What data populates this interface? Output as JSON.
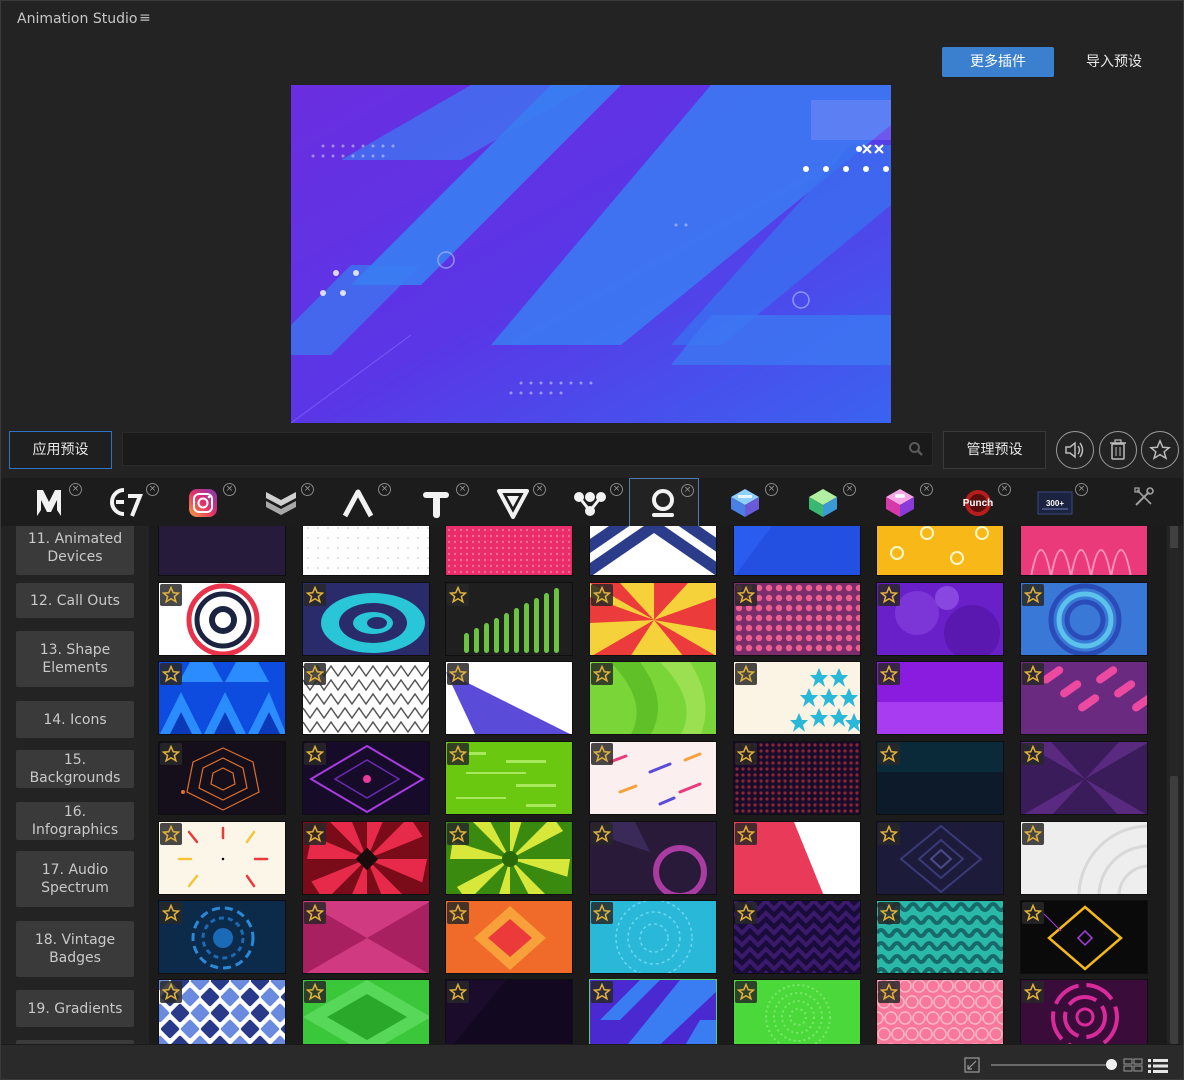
{
  "app": {
    "title": "Animation Studio",
    "menu_glyph": "≡"
  },
  "header": {
    "more_plugins": "更多插件",
    "import_preset": "导入预设"
  },
  "toolbar": {
    "apply_preset": "应用预设",
    "search_placeholder": "",
    "manage_preset": "管理预设",
    "icons": [
      "speaker-icon",
      "trash-icon",
      "star-icon"
    ]
  },
  "plugins": [
    {
      "name": "m-logo"
    },
    {
      "name": "e7-logo"
    },
    {
      "name": "instagram-logo"
    },
    {
      "name": "chevron-badge-logo"
    },
    {
      "name": "a-logo"
    },
    {
      "name": "t-logo"
    },
    {
      "name": "v-logo"
    },
    {
      "name": "nodes-logo"
    },
    {
      "name": "o-logo",
      "active": true
    },
    {
      "name": "cube-blue-logo"
    },
    {
      "name": "cube-green-logo"
    },
    {
      "name": "cube-pink-logo"
    },
    {
      "name": "punch-logo",
      "label": "Punch"
    },
    {
      "name": "transitions-logo",
      "label": "300+"
    }
  ],
  "categories": [
    {
      "label": "11. Animated Devices"
    },
    {
      "label": "12. Call Outs"
    },
    {
      "label": "13. Shape Elements"
    },
    {
      "label": "14. Icons"
    },
    {
      "label": "15. Backgrounds"
    },
    {
      "label": "16. Infographics"
    },
    {
      "label": "17. Audio Spectrum"
    },
    {
      "label": "18. Vintage Badges"
    },
    {
      "label": "19. Gradients"
    }
  ],
  "colors": {
    "accent": "#3b7fcf",
    "selected_border": "#5bd06a",
    "star": "#e2b23a"
  },
  "grid": {
    "selected_row": 6,
    "selected_col": 3
  }
}
